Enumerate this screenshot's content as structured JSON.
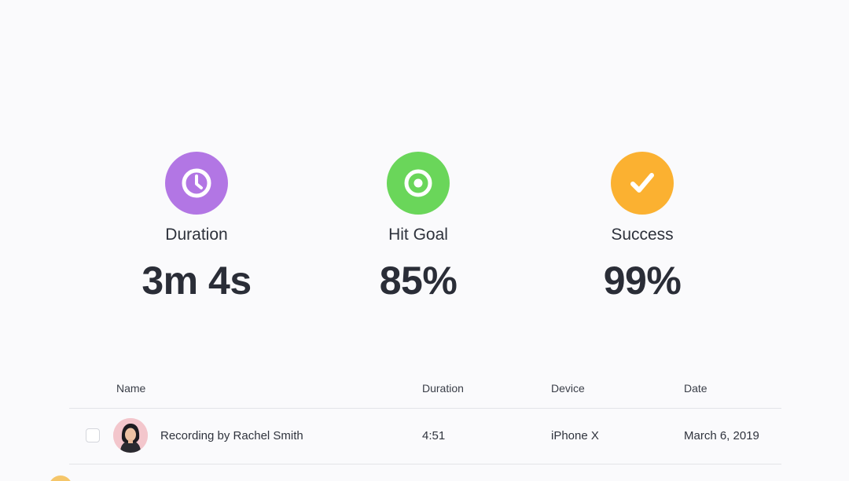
{
  "stats": [
    {
      "label": "Duration",
      "value": "3m 4s",
      "icon": "clock-icon",
      "color": "#b276e4"
    },
    {
      "label": "Hit Goal",
      "value": "85%",
      "icon": "target-icon",
      "color": "#6ad65a"
    },
    {
      "label": "Success",
      "value": "99%",
      "icon": "checkmark-icon",
      "color": "#fbb131"
    }
  ],
  "table": {
    "columns": [
      "Name",
      "Duration",
      "Device",
      "Date"
    ],
    "rows": [
      {
        "name": "Recording by Rachel Smith",
        "duration": "4:51",
        "device": "iPhone X",
        "date": "March 6, 2019",
        "avatar": "user-avatar"
      }
    ]
  }
}
